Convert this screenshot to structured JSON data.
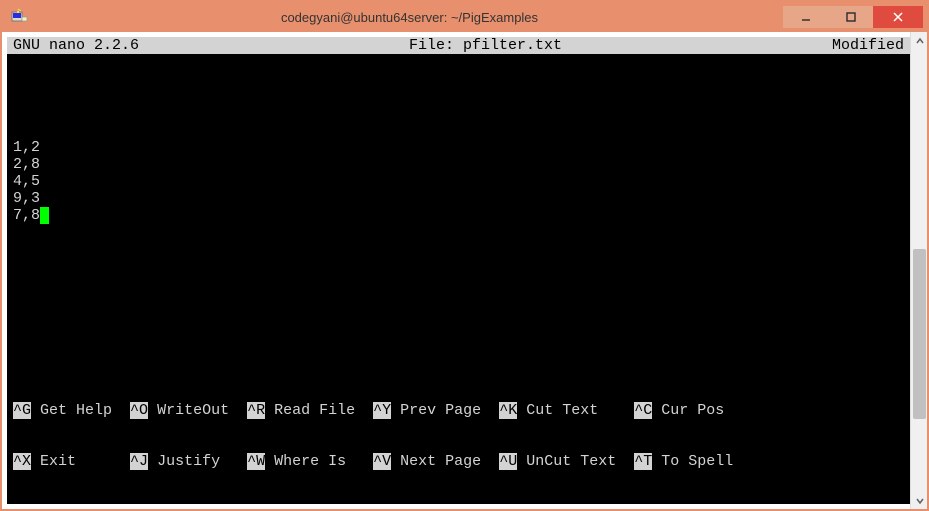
{
  "titlebar": {
    "title": "codegyani@ubuntu64server: ~/PigExamples"
  },
  "nano": {
    "version_label": "GNU nano 2.2.6",
    "file_label": "File: pfilter.txt",
    "modified_label": "Modified"
  },
  "editor_lines": [
    "1,2",
    "2,8",
    "4,5",
    "9,3",
    "7,8"
  ],
  "shortcuts": {
    "row1": [
      {
        "key": "^G",
        "label": "Get Help"
      },
      {
        "key": "^O",
        "label": "WriteOut"
      },
      {
        "key": "^R",
        "label": "Read File"
      },
      {
        "key": "^Y",
        "label": "Prev Page"
      },
      {
        "key": "^K",
        "label": "Cut Text"
      },
      {
        "key": "^C",
        "label": "Cur Pos"
      }
    ],
    "row2": [
      {
        "key": "^X",
        "label": "Exit"
      },
      {
        "key": "^J",
        "label": "Justify"
      },
      {
        "key": "^W",
        "label": "Where Is"
      },
      {
        "key": "^V",
        "label": "Next Page"
      },
      {
        "key": "^U",
        "label": "UnCut Text"
      },
      {
        "key": "^T",
        "label": "To Spell"
      }
    ]
  }
}
